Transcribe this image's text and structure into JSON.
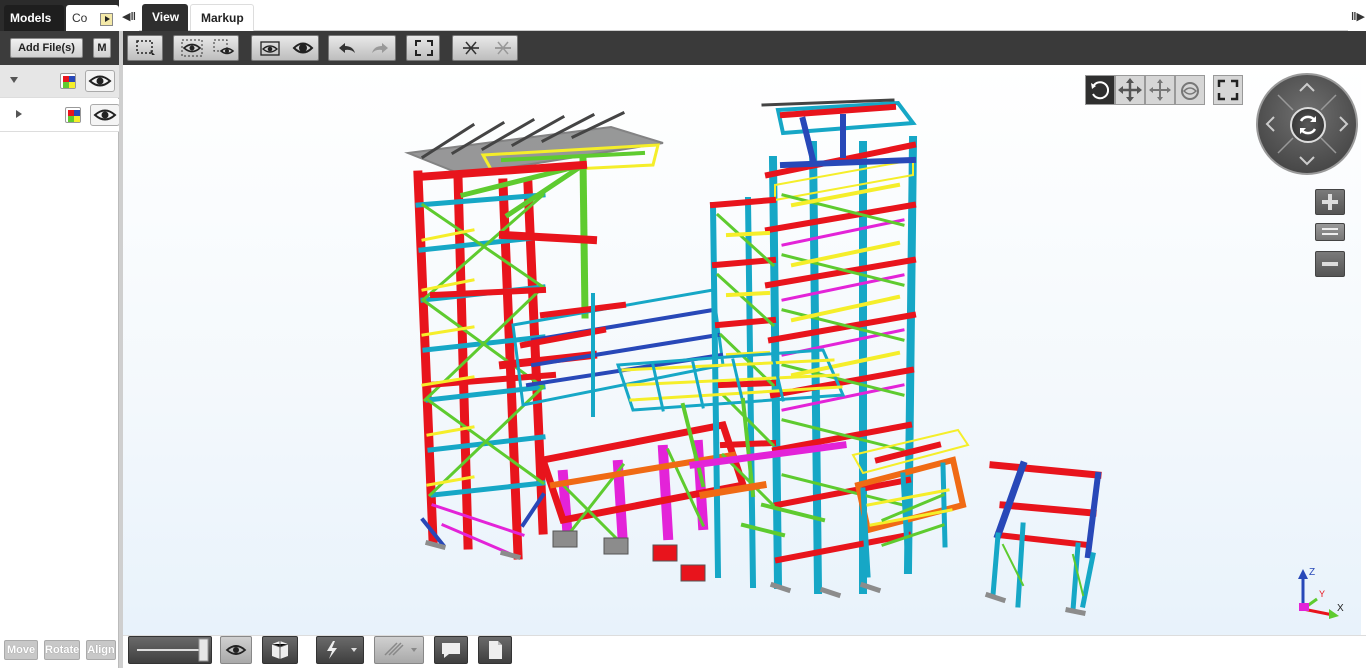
{
  "left_panel": {
    "tabs": [
      {
        "label": "Models"
      },
      {
        "label": "Co"
      }
    ],
    "add_files_label": "Add File(s)",
    "more_label": "M",
    "bottom_buttons": [
      {
        "label": "Move"
      },
      {
        "label": "Rotate"
      },
      {
        "label": "Align"
      }
    ],
    "model_rows": [
      {
        "expanded": true,
        "icon": "color-palette-icon",
        "visibility_icon": "eye-icon"
      },
      {
        "expanded": false,
        "icon": "color-palette-icon",
        "visibility_icon": "eye-icon"
      }
    ]
  },
  "top_tabs": [
    {
      "label": "View",
      "active": true
    },
    {
      "label": "Markup",
      "active": false
    }
  ],
  "toolbar": {
    "groups": [
      {
        "name": "selection",
        "icons": [
          "select-box-icon"
        ]
      },
      {
        "name": "visibility",
        "icons": [
          "hide-icon",
          "show-icon"
        ]
      },
      {
        "name": "isolate",
        "icons": [
          "isolate-icon",
          "show-all-icon"
        ]
      },
      {
        "name": "history",
        "icons": [
          "undo-icon",
          "redo-icon"
        ]
      },
      {
        "name": "fit",
        "icons": [
          "fit-view-icon"
        ]
      },
      {
        "name": "cut",
        "icons": [
          "section-icon",
          "clear-section-icon"
        ]
      }
    ]
  },
  "viewport": {
    "nav_buttons": [
      "orbit-icon",
      "pan-icon",
      "walk-icon",
      "look-icon",
      "fullscreen-icon"
    ],
    "compass": [
      "up-arrow-icon",
      "left-arrow-icon",
      "right-arrow-icon",
      "down-arrow-icon",
      "rotate-center-icon"
    ],
    "zoom": [
      "zoom-in-icon",
      "zoom-slider-icon",
      "zoom-out-icon"
    ],
    "axes": {
      "z": "Z",
      "y": "Y",
      "x": "X"
    },
    "colors": {
      "red": "#e8141c",
      "cyan": "#16a7c6",
      "green": "#5ecb2f",
      "blue": "#2848b8",
      "yellow": "#f5ee2a",
      "magenta": "#e323d8",
      "orange": "#f06a14",
      "gray": "#8c8c8c"
    }
  },
  "bottom_toolbar": {
    "icons": [
      "transparency-slider",
      "eye-icon",
      "box-icon",
      "lightning-icon",
      "measure-icon",
      "comment-icon",
      "document-icon"
    ]
  }
}
